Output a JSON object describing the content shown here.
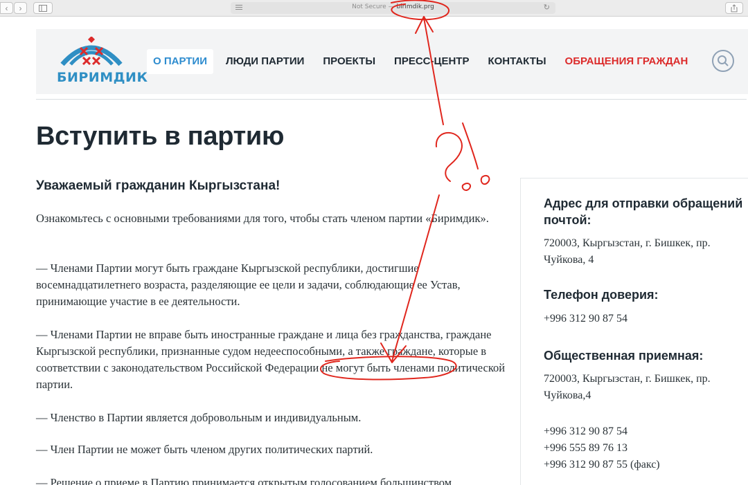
{
  "browser": {
    "security_label": "Not Secure",
    "separator": "—",
    "host": "birimdik.prg"
  },
  "site": {
    "logo_text": "БИРИМДИК",
    "nav": [
      {
        "label": "О ПАРТИИ"
      },
      {
        "label": "ЛЮДИ ПАРТИИ"
      },
      {
        "label": "ПРОЕКТЫ"
      },
      {
        "label": "ПРЕСС-ЦЕНТР"
      },
      {
        "label": "КОНТАКТЫ"
      },
      {
        "label": "ОБРАЩЕНИЯ ГРАЖДАН"
      }
    ]
  },
  "main": {
    "title": "Вступить в партию",
    "greeting": "Уважаемый гражданин Кыргызстана!",
    "intro": "Ознакомьтесь с основными требованиями для того, чтобы стать членом партии «Биримдик».",
    "rules": [
      "— Членами Партии могут быть граждане Кыргызской республики, достигшие восемнадцатилетнего возраста, разделяющие ее цели и задачи, соблюдающие ее Устав, принимающие участие в ее деятельности.",
      "— Членами Партии не вправе быть иностранные граждане и лица без гражданства, граждане Кыргызской республики, признанные судом недееспособными, а также граждане, которые в соответствии с законодательством Российской Федерации не могут быть членами политической партии.",
      "— Членство в Партии является добровольным и индивидуальным.",
      "— Член Партии не может быть членом других политических партий.",
      "— Решение о приеме в Партию принимается открытым голосованием большинством"
    ]
  },
  "sidebar": {
    "mail_heading": "Адрес для отправки обращений почтой:",
    "mail_address": "720003, Кыргызстан, г. Бишкек, пр. Чуйкова, 4",
    "hotline_heading": "Телефон доверия:",
    "hotline_phone": "+996 312 90 87 54",
    "reception_heading": "Общественная приемная:",
    "reception_address": "720003, Кыргызстан, г. Бишкек, пр. Чуйкова,4",
    "phones": [
      "+996 312 90 87 54",
      "+996 555 89 76 13",
      "+996 312 90 87 55 (факс)"
    ]
  },
  "colors": {
    "accent": "#2e8ccf",
    "appeal": "#dc2b2b",
    "annotation": "#e0261d"
  }
}
